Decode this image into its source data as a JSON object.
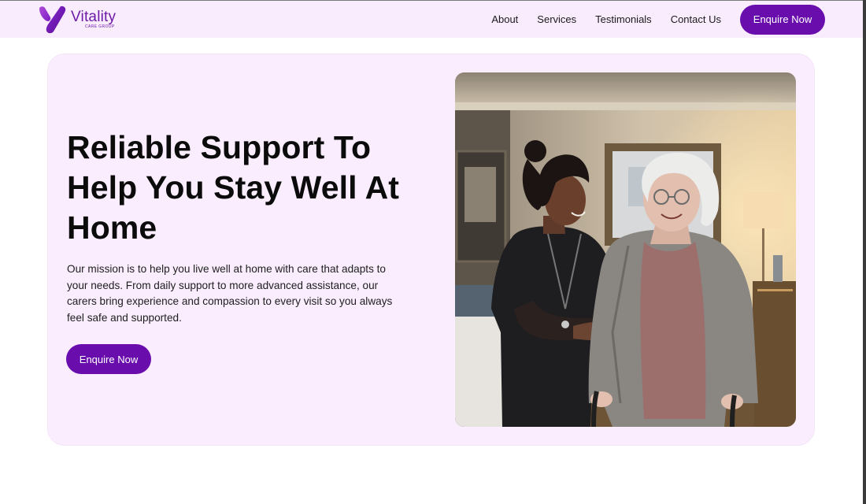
{
  "brand": {
    "name": "Vitality",
    "tagline": "CARE GROUP",
    "accent_color": "#6a0dad",
    "header_bg": "#f9ecfd",
    "hero_bg": "#faeefe"
  },
  "nav": {
    "items": [
      {
        "label": "About"
      },
      {
        "label": "Services"
      },
      {
        "label": "Testimonials"
      },
      {
        "label": "Contact Us"
      }
    ],
    "cta_label": "Enquire Now"
  },
  "hero": {
    "title": "Reliable Support To Help You Stay Well At Home",
    "body": "Our mission is to help you live well at home with care that adapts to your needs. From daily support to more advanced assistance, our carers bring experience and compassion to every visit so you always feel safe and supported.",
    "cta_label": "Enquire Now",
    "image_icon": "photo-carer-and-elderly-woman"
  }
}
